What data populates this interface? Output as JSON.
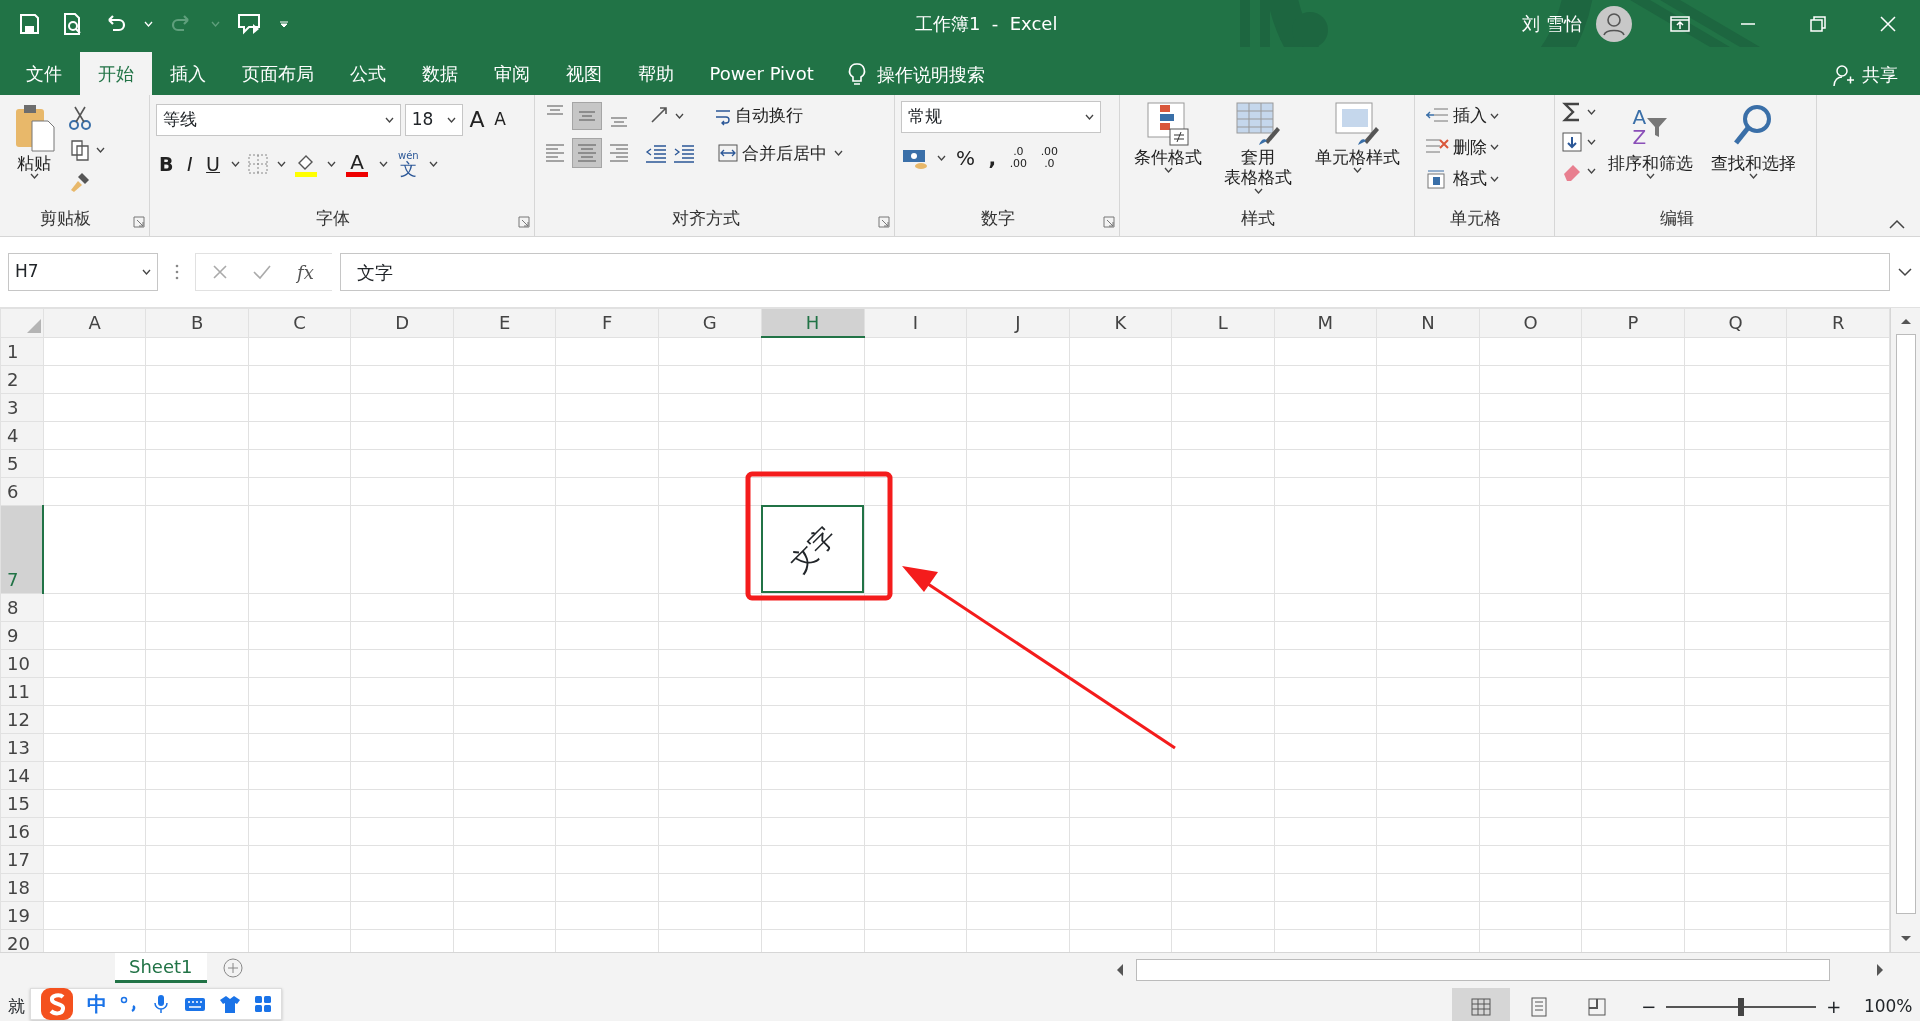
{
  "window": {
    "title": "工作簿1  -  Excel",
    "user": "刘 雪怡"
  },
  "tabs": [
    {
      "label": "文件",
      "selected": false
    },
    {
      "label": "开始",
      "selected": true
    },
    {
      "label": "插入",
      "selected": false
    },
    {
      "label": "页面布局",
      "selected": false
    },
    {
      "label": "公式",
      "selected": false
    },
    {
      "label": "数据",
      "selected": false
    },
    {
      "label": "审阅",
      "selected": false
    },
    {
      "label": "视图",
      "selected": false
    },
    {
      "label": "帮助",
      "selected": false
    },
    {
      "label": "Power Pivot",
      "selected": false
    }
  ],
  "tell_me": {
    "placeholder": "操作说明搜索"
  },
  "share": "共享",
  "ribbon": {
    "clipboard": {
      "label": "剪贴板",
      "paste": "粘贴"
    },
    "font": {
      "label": "字体",
      "font_name": "等线",
      "font_size": "18",
      "grow": "A",
      "shrink": "A",
      "style_buttons": [
        {
          "label": "B",
          "kind": "bold"
        },
        {
          "label": "I",
          "kind": "italic"
        },
        {
          "label": "U",
          "kind": "underline"
        }
      ],
      "font_color": "A",
      "phonetic_reading": "wén",
      "phonetic_char": "文"
    },
    "alignment": {
      "label": "对齐方式",
      "vertical": [
        {
          "kind": "top",
          "selected": false
        },
        {
          "kind": "middle",
          "selected": true
        },
        {
          "kind": "bottom",
          "selected": false
        }
      ],
      "horizontal": [
        {
          "kind": "left",
          "selected": false
        },
        {
          "kind": "center",
          "selected": true
        },
        {
          "kind": "right",
          "selected": false
        }
      ],
      "wrap": "自动换行",
      "merge": "合并后居中"
    },
    "number": {
      "label": "数字",
      "format": "常规",
      "percent": "%",
      "comma": ",",
      "increase_decimal": [
        ".0",
        ".00"
      ],
      "decrease_decimal": [
        ".00",
        ".0"
      ]
    },
    "styles": {
      "label": "样式",
      "buttons": [
        {
          "lines": [
            "条件格式"
          ],
          "kind": "conditional"
        },
        {
          "lines": [
            "套用",
            "表格格式"
          ],
          "kind": "table"
        },
        {
          "lines": [
            "单元格样式"
          ],
          "kind": "cell"
        }
      ]
    },
    "cells": {
      "label": "单元格",
      "buttons": [
        {
          "label": "插入",
          "kind": "insert"
        },
        {
          "label": "删除",
          "kind": "delete"
        },
        {
          "label": "格式",
          "kind": "format"
        }
      ]
    },
    "editing": {
      "label": "编辑",
      "sort": "排序和筛选",
      "find": "查找和选择",
      "sort_letters": [
        "A",
        "Z"
      ]
    }
  },
  "formula_bar": {
    "name_box": "H7",
    "fx": "fx",
    "value": "文字"
  },
  "sheet": {
    "columns": [
      {
        "label": "A",
        "selected": false
      },
      {
        "label": "B",
        "selected": false
      },
      {
        "label": "C",
        "selected": false
      },
      {
        "label": "D",
        "selected": false
      },
      {
        "label": "E",
        "selected": false
      },
      {
        "label": "F",
        "selected": false
      },
      {
        "label": "G",
        "selected": false
      },
      {
        "label": "H",
        "selected": true
      },
      {
        "label": "I",
        "selected": false
      },
      {
        "label": "J",
        "selected": false
      },
      {
        "label": "K",
        "selected": false
      },
      {
        "label": "L",
        "selected": false
      },
      {
        "label": "M",
        "selected": false
      },
      {
        "label": "N",
        "selected": false
      },
      {
        "label": "O",
        "selected": false
      },
      {
        "label": "P",
        "selected": false
      },
      {
        "label": "Q",
        "selected": false
      },
      {
        "label": "R",
        "selected": false
      }
    ],
    "rows": [
      {
        "label": "1",
        "selected": false
      },
      {
        "label": "2",
        "selected": false
      },
      {
        "label": "3",
        "selected": false
      },
      {
        "label": "4",
        "selected": false
      },
      {
        "label": "5",
        "selected": false
      },
      {
        "label": "6",
        "selected": false
      },
      {
        "label": "7",
        "selected": true
      },
      {
        "label": "8",
        "selected": false
      },
      {
        "label": "9",
        "selected": false
      },
      {
        "label": "10",
        "selected": false
      },
      {
        "label": "11",
        "selected": false
      },
      {
        "label": "12",
        "selected": false
      },
      {
        "label": "13",
        "selected": false
      },
      {
        "label": "14",
        "selected": false
      },
      {
        "label": "15",
        "selected": false
      },
      {
        "label": "16",
        "selected": false
      },
      {
        "label": "17",
        "selected": false
      },
      {
        "label": "18",
        "selected": false
      },
      {
        "label": "19",
        "selected": false
      },
      {
        "label": "20",
        "selected": false
      }
    ],
    "cells": [
      {
        "text": "文字",
        "angled": true
      }
    ],
    "callout": {
      "kind": "box_arrow"
    }
  },
  "sheet_tabs": [
    {
      "label": "Sheet1",
      "selected": true
    }
  ],
  "ime_toolbar": {
    "mode": "中"
  },
  "status_bar": {
    "status": "就",
    "views": [
      {
        "kind": "normal",
        "selected": true
      },
      {
        "kind": "page_layout",
        "selected": false
      },
      {
        "kind": "page_break",
        "selected": false
      }
    ],
    "zoom_out": "−",
    "zoom_in": "+",
    "zoom": {
      "level": 0.5
    },
    "zoom_label": "100%"
  }
}
